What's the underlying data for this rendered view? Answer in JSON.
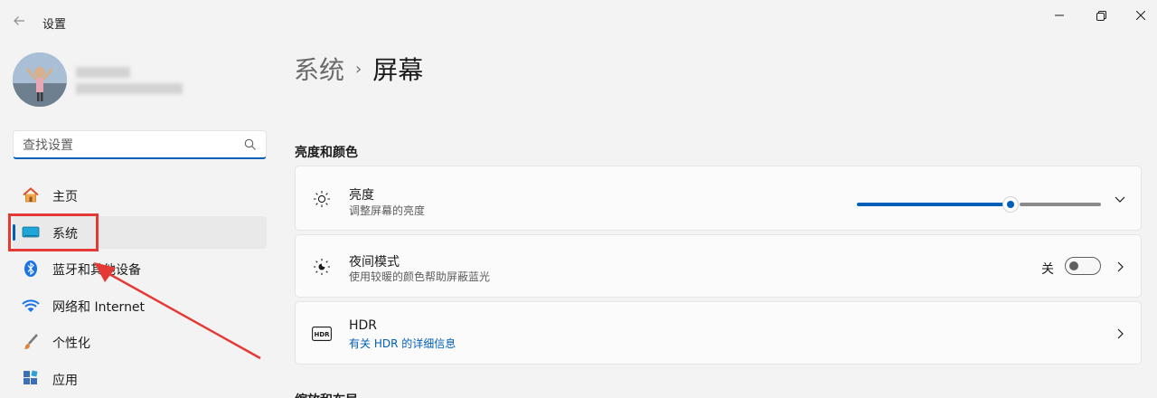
{
  "window": {
    "title": "设置"
  },
  "search": {
    "placeholder": "查找设置"
  },
  "sidebar": {
    "items": [
      {
        "label": "主页",
        "icon": "home-icon",
        "active": false
      },
      {
        "label": "系统",
        "icon": "display-icon",
        "active": true
      },
      {
        "label": "蓝牙和其他设备",
        "icon": "bluetooth-icon",
        "active": false
      },
      {
        "label": "网络和 Internet",
        "icon": "wifi-icon",
        "active": false
      },
      {
        "label": "个性化",
        "icon": "brush-icon",
        "active": false
      },
      {
        "label": "应用",
        "icon": "apps-icon",
        "active": false
      }
    ]
  },
  "breadcrumb": {
    "parent": "系统",
    "separator": "›",
    "current": "屏幕"
  },
  "sections": {
    "brightness_color": "亮度和颜色",
    "next_section": "缩放和布局"
  },
  "cards": {
    "brightness": {
      "title": "亮度",
      "subtitle": "调整屏幕的亮度",
      "value_fraction": 0.63,
      "icon": "brightness-icon"
    },
    "night_mode": {
      "title": "夜间模式",
      "subtitle": "使用较暖的颜色帮助屏蔽蓝光",
      "toggle_label": "关",
      "toggle_on": false,
      "icon": "night-light-icon"
    },
    "hdr": {
      "title": "HDR",
      "subtitle": "有关 HDR 的详细信息",
      "icon": "hdr-icon"
    }
  },
  "colors": {
    "accent": "#005fb8",
    "annotation": "#e53935"
  }
}
